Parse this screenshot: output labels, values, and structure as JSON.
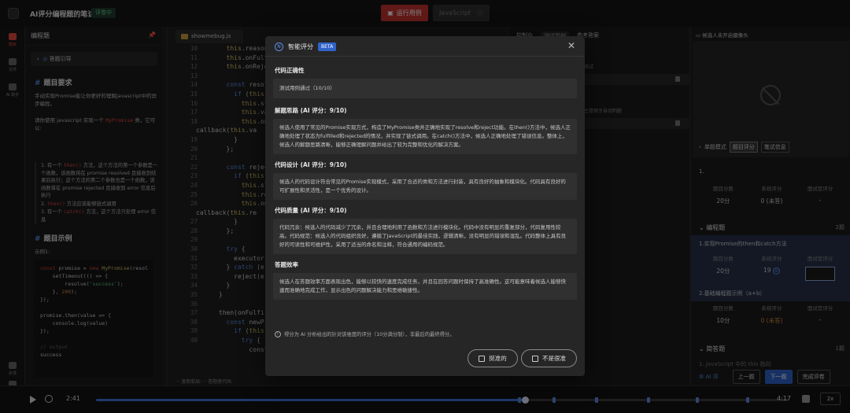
{
  "topbar": {
    "title": "AI评分编程题的笔试",
    "badge": "评卷中",
    "run_button": "运行用例",
    "language": "JavaScript"
  },
  "rail": {
    "items": [
      {
        "label": "题目",
        "icon": "doc-icon"
      },
      {
        "label": "文件",
        "icon": "folder-icon"
      },
      {
        "label": "AI 助手",
        "icon": "ai-icon"
      },
      {
        "label": "反馈",
        "icon": "feedback-icon"
      },
      {
        "label": "设置",
        "icon": "settings-icon"
      }
    ]
  },
  "problem": {
    "header": "编程题",
    "guide": "答题引导",
    "req_title": "题目要求",
    "intro": "手动实现Promise能让你更好的理解Javascript中的异步编程。",
    "req_pre": "请你使用 javascript 实现一个 ",
    "req_code": "MyPromise",
    "req_post": " 类，它可以:",
    "items": [
      {
        "num": "1.",
        "pre": "有一个 ",
        "code": "then()",
        "post": " 方法，这个方法的第一个参数是一个函数，该函数将在 promise resolved 且接收到结果后执行；这个方法的第二个参数也是一个函数，该函数将在 promise rejected 且接收到 error 信息后执行"
      },
      {
        "num": "2.",
        "pre": "",
        "code": "then()",
        "post": " 方法应该能够链式调用"
      },
      {
        "num": "3.",
        "pre": "有一个 ",
        "code": "catch()",
        "post": " 方法，这个方法只处理 error 信息"
      }
    ],
    "example_title": "题目示例",
    "example_label": "示例1:"
  },
  "editor": {
    "file_name": "showmebug.js",
    "line_numbers": [
      "10",
      "11",
      "12",
      "13",
      "14",
      "15",
      "16",
      "17",
      "18",
      "",
      "19",
      "20",
      "21",
      "22",
      "23",
      "24",
      "25",
      "26",
      "",
      "27",
      "28",
      "29",
      "30",
      "31",
      "32",
      "33",
      "34",
      "35",
      "36",
      "37",
      "38",
      "39",
      "40"
    ],
    "footer": "··· 复制粘贴    ··· 答题者代码"
  },
  "right_mid": {
    "tabs": [
      "控制台",
      "测试用例",
      "参考答案"
    ],
    "rows": [
      "测试",
      "主管用于自动判题"
    ]
  },
  "right_panel": {
    "camera_label": "候选人未开启摄像头",
    "mode_label": "单题模式",
    "mode_buttons": [
      "题目评分",
      "笔试信息"
    ],
    "q0_label": "1.",
    "col_headers": [
      "题目分数",
      "系统评分",
      "面试官评分"
    ],
    "q0_values": [
      "20分",
      "0 (未答)",
      "-"
    ],
    "section_coding": "编程题",
    "section_coding_count": "2题",
    "q1_label": "1.实现Promise的then和catch方法",
    "q1_values": [
      "20分",
      "19",
      ""
    ],
    "q2_label": "2.基础编程题示例（a+b）",
    "q2_values": [
      "10分",
      "0 (未答)",
      "-"
    ],
    "section_short": "简答题",
    "section_short_count": "1题",
    "q3_label": "1. JavaScript 中的 this 指向",
    "footer_ai": "AI 评",
    "footer_buttons": [
      "上一题",
      "下一题",
      "完成评卷"
    ]
  },
  "player": {
    "current_time": "2:41",
    "total_time": "4:17",
    "progress": 0.62,
    "speed": "2x"
  },
  "modal": {
    "title": "智能评分",
    "beta": "BETA",
    "sections": [
      {
        "title": "代码正确性",
        "text": "测试用例通过（10/10）"
      },
      {
        "title": "解题思路 (AI 评分：9/10)",
        "text": "候选人使用了常见的Promise实现方式，构造了MyPromise类并正确地实现了resolve和reject功能。在then()方法中，候选人正确地处理了状态为fulfilled和rejected的情况，并实现了链式调用。在catch()方法中，候选人正确地处理了错误信息。整体上，候选人的解题思路清晰，能够正确理解问题并给出了较为完整和优化的解决方案。"
      },
      {
        "title": "代码设计 (AI 评分：9/10)",
        "text": "候选人的代码设计符合常见的Promise实现模式，采用了合适的类和方法进行封装，具有良好的抽象和模块化。代码具有良好的可扩展性和灵活性，是一个优秀的设计。"
      },
      {
        "title": "代码质量 (AI 评分：9/10)",
        "text": "代码冗余：候选人的代码减少了冗余，并且合理地利用了函数和方法进行模块化。代码中没有明显的重复部分，代码复用性较高。代码规范：候选人的代码组织良好，遵循了JavaScript的最佳实践，逻辑清晰，没有明显的错误和混乱。代码整体上具有良好的可读性和可维护性，采用了适当的命名和注释，符合通用的编码规范。"
      },
      {
        "title": "答题效率",
        "text": "候选人在答题效率方面表现出色，能够以较快的速度完成任务，并且在回答问题时保持了高准确性。这可能意味着候选人能够快速而准确地完成工作，显示出色的问题解决能力和思维敏捷性。"
      }
    ],
    "note": "得分为 AI 分析给出的针对该维度的评分（10分满分制），非最后的最终得分。",
    "btn_like": "挺准的",
    "btn_dislike": "不是很准"
  }
}
